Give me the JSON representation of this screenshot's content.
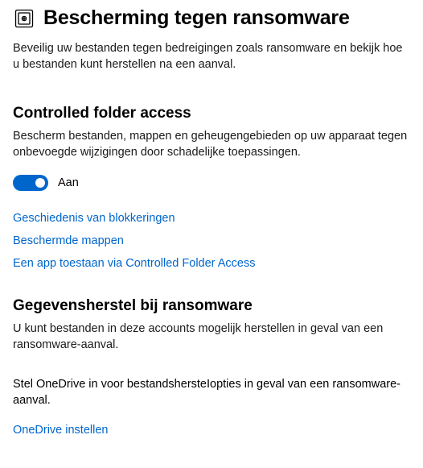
{
  "header": {
    "title": "Bescherming tegen ransomware",
    "description": "Beveilig uw bestanden tegen bedreigingen zoals ransomware en bekijk hoe u bestanden kunt herstellen na een aanval."
  },
  "controlledFolderAccess": {
    "title": "Controlled folder access",
    "description": "Bescherm bestanden, mappen en geheugengebieden op uw apparaat tegen onbevoegde wijzigingen door schadelijke toepassingen.",
    "toggleLabel": "Aan",
    "links": {
      "blockHistory": "Geschiedenis van blokkeringen",
      "protectedFolders": "Beschermde mappen",
      "allowApp": "Een app toestaan via Controlled Folder Access"
    }
  },
  "dataRecovery": {
    "title": "Gegevensherstel bij ransomware",
    "description": "U kunt bestanden in deze accounts mogelijk herstellen in geval van een ransomware-aanval.",
    "onedriveSetupText": "Stel OneDrive in voor bestandshersteIopties in geval van een ransomware-aanval.",
    "onedriveLink": "OneDrive instellen"
  }
}
